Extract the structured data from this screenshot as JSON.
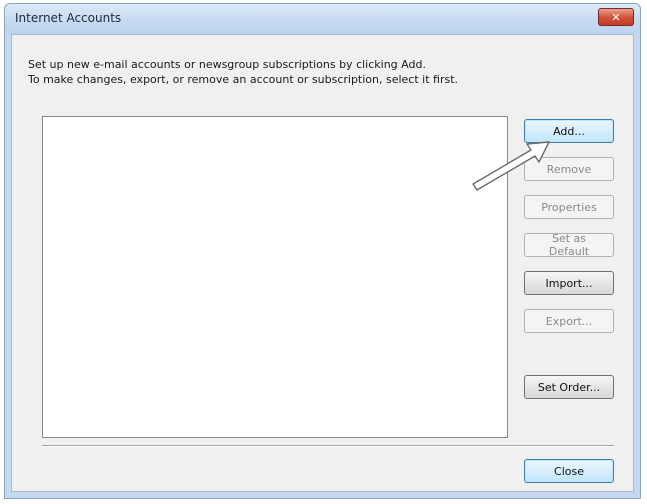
{
  "window": {
    "title": "Internet Accounts",
    "close_glyph": "✕"
  },
  "instructions": {
    "line1": "Set up new e-mail accounts or newsgroup subscriptions by clicking Add.",
    "line2": "To make changes, export, or remove an account or subscription, select it first."
  },
  "buttons": {
    "add": "Add...",
    "remove": "Remove",
    "properties": "Properties",
    "set_default": "Set as Default",
    "import": "Import...",
    "export": "Export...",
    "set_order": "Set Order...",
    "close": "Close"
  },
  "icons": {
    "annotation_arrow": "arrow-pointer-icon"
  },
  "colors": {
    "frame": "#c4d8ef",
    "default_button_border": "#3c7fb1",
    "close_button_red": "#c03b24"
  }
}
